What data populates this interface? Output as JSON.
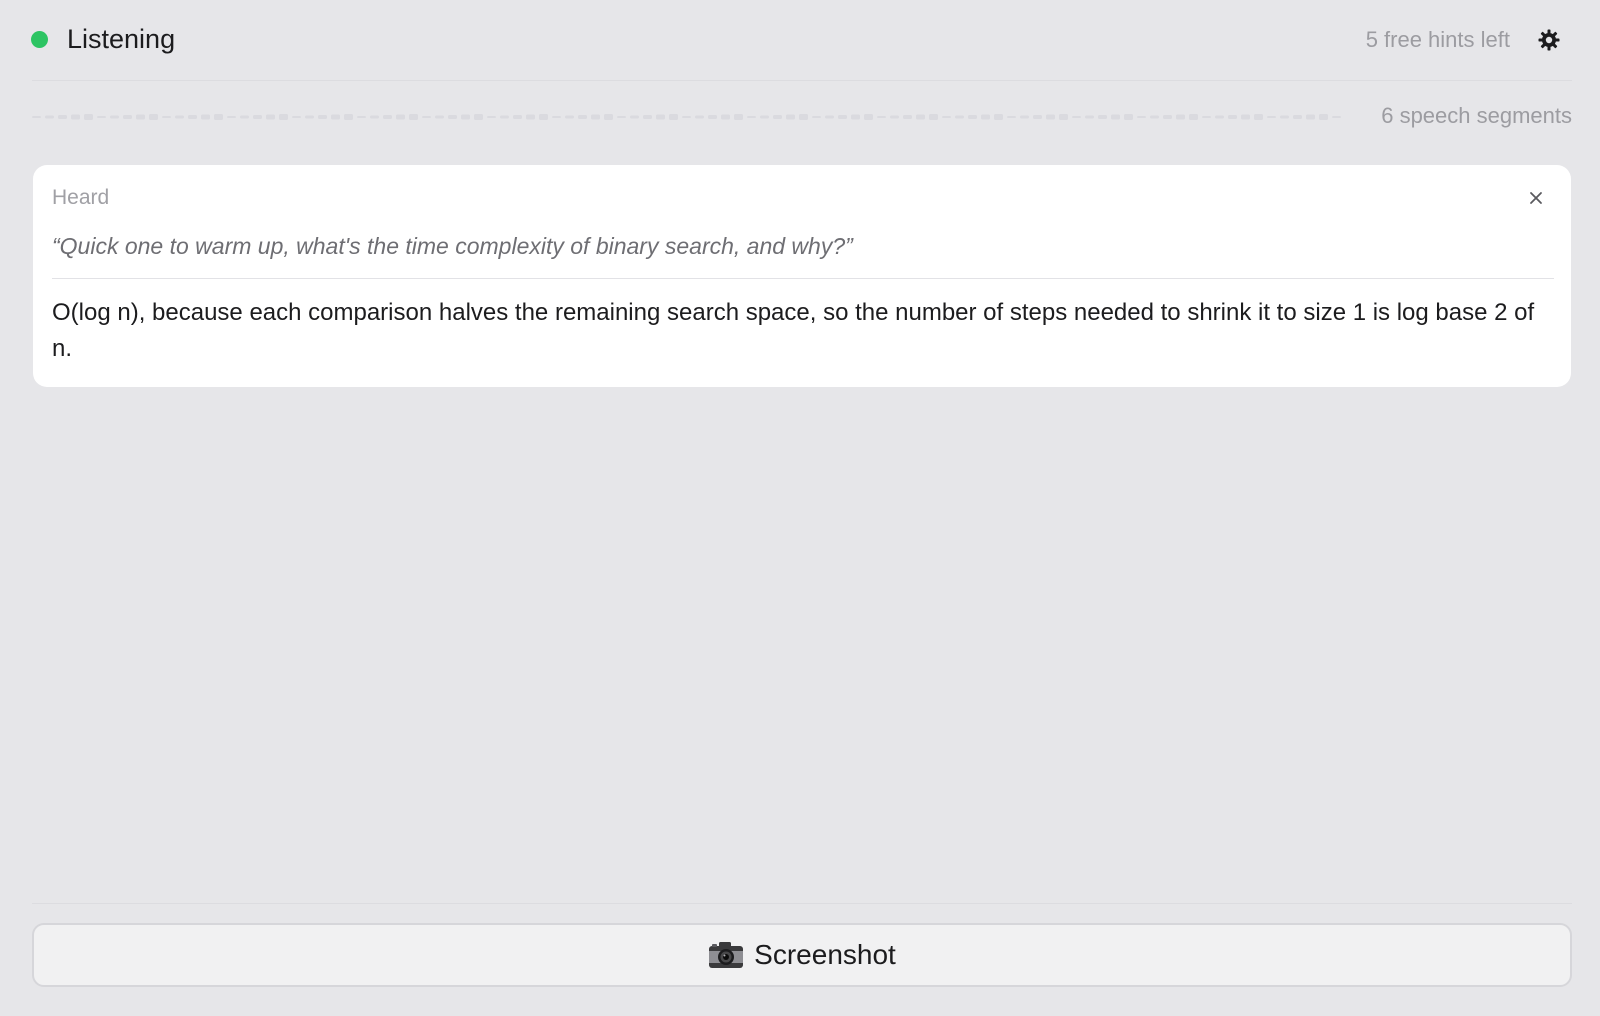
{
  "header": {
    "status_text": "Listening",
    "status_color": "#2dc463",
    "hints_text": "5 free hints left",
    "settings_icon": "gear-icon"
  },
  "audio": {
    "segments_text": "6 speech segments"
  },
  "card": {
    "label": "Heard",
    "close_icon": "close-icon",
    "quote": "“Quick one to warm up, what's the time complexity of binary search, and why?”",
    "answer": "O(log n), because each comparison halves the remaining search space, so the number of steps needed to shrink it to size 1 is log base 2 of n."
  },
  "footer": {
    "button_icon": "camera-icon",
    "button_label": "Screenshot"
  }
}
